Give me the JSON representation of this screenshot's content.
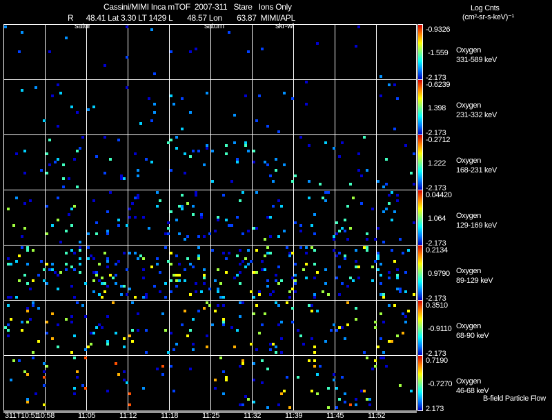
{
  "header": {
    "title": "Cassini/MIMI Inca mTOF  2007-311   Stare   Ions Only",
    "subtitle": "R      48.41 Lat 3.30 LT 1429 L       48.57 Lon       63.87  MIMI/APL",
    "units_line1": "Log Cnts",
    "units_line2": "(cm²-sr-s-keV)⁻¹"
  },
  "markers": [
    "satur",
    "saturn",
    "skr-wl"
  ],
  "footer": "B-field Particle Flow",
  "chart_data": {
    "type": "heatmap",
    "title": "Cassini/MIMI Inca mTOF 2007-311 Stare Ions Only",
    "x_ticks": [
      "311T10:51",
      "10:58",
      "11:05",
      "11:12",
      "11:18",
      "11:25",
      "11:32",
      "11:39",
      "11:45",
      "11:52"
    ],
    "panels": [
      {
        "species": "Oxygen",
        "energy": "331-589 keV",
        "cmax": "-0.9326",
        "cmid": "-1.559",
        "cmin": "-2.173",
        "density": 0.004
      },
      {
        "species": "Oxygen",
        "energy": "231-332 keV",
        "cmax": "-0.6239",
        "cmid": "1.398",
        "cmin": "-2.173",
        "density": 0.012
      },
      {
        "species": "Oxygen",
        "energy": "168-231 keV",
        "cmax": "-0.2712",
        "cmid": "1.222",
        "cmin": "-2.173",
        "density": 0.03
      },
      {
        "species": "Oxygen",
        "energy": "129-169 keV",
        "cmax": "0.04420",
        "cmid": "1.064",
        "cmin": "-2.173",
        "density": 0.045
      },
      {
        "species": "Oxygen",
        "energy": "89-129 keV",
        "cmax": "0.2134",
        "cmid": "0.9790",
        "cmin": "-2.173",
        "density": 0.09
      },
      {
        "species": "Oxygen",
        "energy": "68-90 keV",
        "cmax": "0.3510",
        "cmid": "-0.9110",
        "cmin": "-2.173",
        "density": 0.05
      },
      {
        "species": "Oxygen",
        "energy": "46-68 keV",
        "cmax": "0.7190",
        "cmid": "-0.7270",
        "cmin": "2.173",
        "density": 0.035
      }
    ]
  }
}
